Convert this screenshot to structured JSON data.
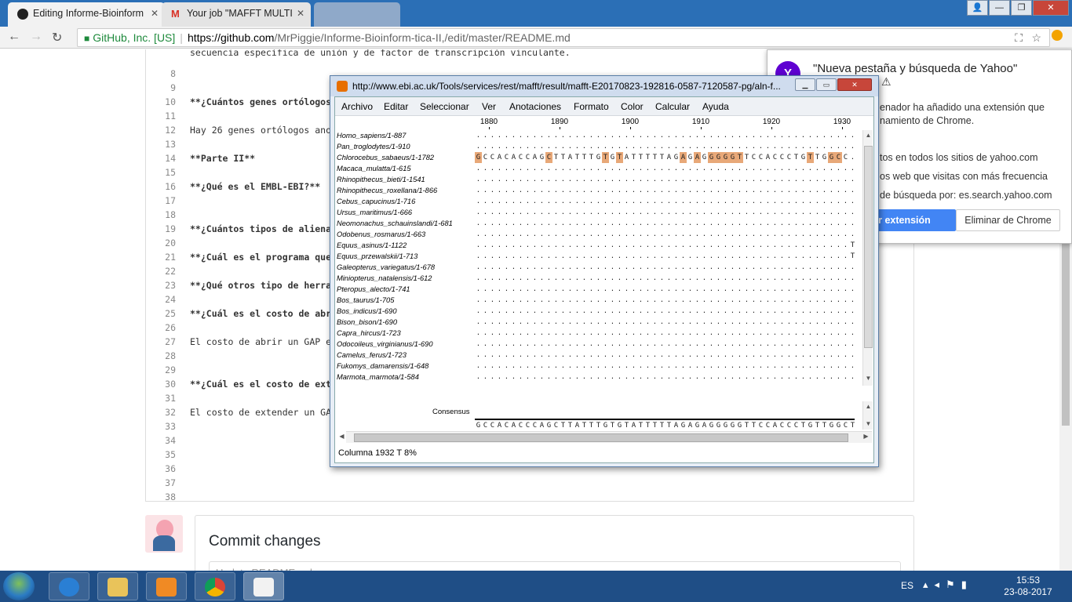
{
  "browser": {
    "tabs": [
      {
        "title": "Editing Informe-Bioinform",
        "active": true,
        "icon": "github-icon"
      },
      {
        "title": "Your job \"MAFFT MULTI",
        "active": false,
        "icon": "gmail-icon"
      },
      {
        "title": "",
        "active": false,
        "icon": "blank"
      }
    ],
    "secure_label": "GitHub, Inc. [US]",
    "url_host": "https://github.com",
    "url_path": "/MrPiggie/Informe-Bioinform-tica-II,/edit/master/README.md"
  },
  "editor": {
    "lines": [
      {
        "n": "",
        "text": "secuencia específica de unión y de factor de transcripción vinculante.",
        "bold": false
      },
      {
        "n": "8",
        "text": "",
        "bold": false
      },
      {
        "n": "9",
        "text": "",
        "bold": false
      },
      {
        "n": "10",
        "text": "**¿Cuántos genes ortólogos",
        "bold": true
      },
      {
        "n": "11",
        "text": "",
        "bold": false
      },
      {
        "n": "12",
        "text": "Hay 26 genes ortólogos anot",
        "bold": false
      },
      {
        "n": "13",
        "text": "",
        "bold": false
      },
      {
        "n": "14",
        "text": "**Parte II**",
        "bold": true
      },
      {
        "n": "15",
        "text": "",
        "bold": false
      },
      {
        "n": "16",
        "text": "**¿Qué es el EMBL-EBI?**",
        "bold": true
      },
      {
        "n": "17",
        "text": "",
        "bold": false
      },
      {
        "n": "18",
        "text": "",
        "bold": false
      },
      {
        "n": "19",
        "text": "**¿Cuántos tipos de alienam",
        "bold": true
      },
      {
        "n": "20",
        "text": "",
        "bold": false
      },
      {
        "n": "21",
        "text": "**¿Cuál es el programa que",
        "bold": true
      },
      {
        "n": "22",
        "text": "",
        "bold": false
      },
      {
        "n": "23",
        "text": "**¿Qué otros tipo de herram",
        "bold": true
      },
      {
        "n": "24",
        "text": "",
        "bold": false
      },
      {
        "n": "25",
        "text": "**¿Cuál es el costo de abri",
        "bold": true
      },
      {
        "n": "26",
        "text": "",
        "bold": false
      },
      {
        "n": "27",
        "text": "El costo de abrir un GAP es",
        "bold": false
      },
      {
        "n": "28",
        "text": "",
        "bold": false
      },
      {
        "n": "29",
        "text": "",
        "bold": false
      },
      {
        "n": "30",
        "text": "**¿Cuál es el costo de exte",
        "bold": true
      },
      {
        "n": "31",
        "text": "",
        "bold": false
      },
      {
        "n": "32",
        "text": "El costo de extender un GAP",
        "bold": false
      },
      {
        "n": "33",
        "text": "",
        "bold": false
      },
      {
        "n": "34",
        "text": "",
        "bold": false
      },
      {
        "n": "35",
        "text": "",
        "bold": false
      },
      {
        "n": "36",
        "text": "",
        "bold": false
      },
      {
        "n": "37",
        "text": "",
        "bold": false
      },
      {
        "n": "38",
        "text": "",
        "bold": false
      }
    ],
    "commit_title": "Commit changes",
    "commit_placeholder": "Update README.md"
  },
  "extension_popup": {
    "icon_letter": "Y",
    "title": "\"Nueva pestaña y búsqueda de Yahoo\"",
    "lines": [
      "enador ha añadido una extensión que",
      "namiento de Chrome.",
      "tos en todos los sitios de yahoo.com",
      "os web que visitas con más frecuencia",
      "de búsqueda por: es.search.yahoo.com"
    ],
    "enable_label": "tar extensión",
    "remove_label": "Eliminar de Chrome"
  },
  "jalview": {
    "title": "http://www.ebi.ac.uk/Tools/services/rest/mafft/result/mafft-E20170823-192816-0587-7120587-pg/aln-f...",
    "menu": [
      "Archivo",
      "Editar",
      "Seleccionar",
      "Ver",
      "Anotaciones",
      "Formato",
      "Color",
      "Calcular",
      "Ayuda"
    ],
    "ruler": [
      "1880",
      "1890",
      "1900",
      "1910",
      "1920",
      "1930"
    ],
    "sequences": [
      {
        "name": "Homo_sapiens/1-887",
        "residues": ""
      },
      {
        "name": "Pan_troglodytes/1-910",
        "residues": ""
      },
      {
        "name": "Chlorocebus_sabaeus/1-1782",
        "residues": "GCCACACCAGCTTATTTGTGTATTTTTAGAGAGGGGGTTCCACCCTGTTGGCC"
      },
      {
        "name": "Macaca_mulatta/1-615",
        "residues": ""
      },
      {
        "name": "Rhinopithecus_bieti/1-1541",
        "residues": ""
      },
      {
        "name": "Rhinopithecus_roxellana/1-866",
        "residues": ""
      },
      {
        "name": "Cebus_capucinus/1-716",
        "residues": ""
      },
      {
        "name": "Ursus_maritimus/1-666",
        "residues": ""
      },
      {
        "name": "Neomonachus_schauinslandi/1-681",
        "residues": ""
      },
      {
        "name": "Odobenus_rosmarus/1-663",
        "residues": ""
      },
      {
        "name": "Equus_asinus/1-1122",
        "residues": "T"
      },
      {
        "name": "Equus_przewalskii/1-713",
        "residues": "T"
      },
      {
        "name": "Galeopterus_variegatus/1-678",
        "residues": ""
      },
      {
        "name": "Miniopterus_natalensis/1-612",
        "residues": ""
      },
      {
        "name": "Pteropus_alecto/1-741",
        "residues": ""
      },
      {
        "name": "Bos_taurus/1-705",
        "residues": ""
      },
      {
        "name": "Bos_indicus/1-690",
        "residues": ""
      },
      {
        "name": "Bison_bison/1-690",
        "residues": ""
      },
      {
        "name": "Capra_hircus/1-723",
        "residues": ""
      },
      {
        "name": "Odocoileus_virginianus/1-690",
        "residues": ""
      },
      {
        "name": "Camelus_ferus/1-723",
        "residues": ""
      },
      {
        "name": "Fukomys_damarensis/1-648",
        "residues": ""
      },
      {
        "name": "Marmota_marmota/1-584",
        "residues": ""
      }
    ],
    "highlight_columns": [
      0,
      10,
      18,
      20,
      29,
      31,
      33,
      34,
      35,
      36,
      37,
      47,
      50,
      51
    ],
    "consensus_label": "Consensus",
    "consensus": "GCCACACCCAGCTTATTTGTGTATTTTTAGAGAGGGGGTTCCACCCTGTTGGCT",
    "status": "Columna 1932  T 8%",
    "highlight_color": "#e8a878"
  },
  "taskbar": {
    "lang": "ES",
    "time": "15:53",
    "date": "23-08-2017"
  }
}
